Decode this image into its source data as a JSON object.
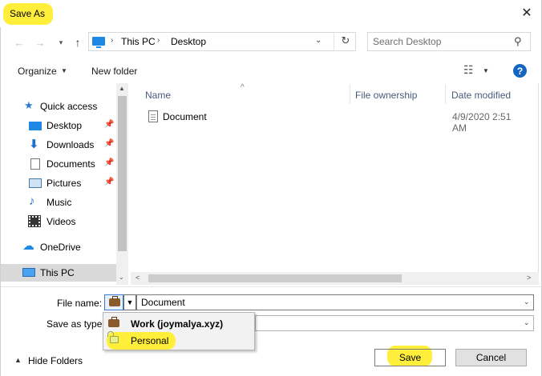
{
  "window": {
    "title": "Save As"
  },
  "address": {
    "crumbs": [
      "This PC",
      "Desktop"
    ],
    "search_placeholder": "Search Desktop"
  },
  "toolbar": {
    "organize": "Organize",
    "new_folder": "New folder"
  },
  "nav": {
    "quick_access": "Quick access",
    "items": [
      "Desktop",
      "Downloads",
      "Documents",
      "Pictures",
      "Music",
      "Videos"
    ],
    "onedrive": "OneDrive",
    "this_pc": "This PC"
  },
  "columns": {
    "name": "Name",
    "owner": "File ownership",
    "date": "Date modified"
  },
  "files": [
    {
      "name": "Document",
      "date": "4/9/2020 2:51 AM"
    }
  ],
  "form": {
    "file_name_label": "File name:",
    "file_name_value": "Document",
    "save_type_label": "Save as type:"
  },
  "protection_menu": {
    "work": "Work (joymalya.xyz)",
    "personal": "Personal"
  },
  "buttons": {
    "hide_folders": "Hide Folders",
    "save": "Save",
    "cancel": "Cancel"
  },
  "colors": {
    "highlight": "#ffef3a",
    "accent": "#1565c0",
    "selected_nav": "#d9d9d9"
  }
}
